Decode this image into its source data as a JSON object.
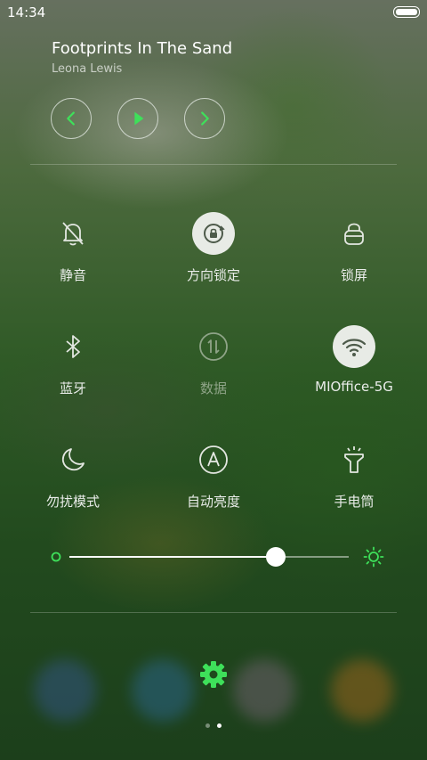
{
  "status": {
    "time": "14:34"
  },
  "media": {
    "title": "Footprints In The Sand",
    "artist": "Leona Lewis",
    "controls": [
      "previous-icon",
      "play-icon",
      "next-icon"
    ]
  },
  "tiles": [
    {
      "label": "静音",
      "icon": "bell-muted-icon",
      "state": "off"
    },
    {
      "label": "方向锁定",
      "icon": "rotation-lock-icon",
      "state": "on"
    },
    {
      "label": "锁屏",
      "icon": "lock-icon",
      "state": "off"
    },
    {
      "label": "蓝牙",
      "icon": "bluetooth-icon",
      "state": "off"
    },
    {
      "label": "数据",
      "icon": "mobile-data-icon",
      "state": "disabled"
    },
    {
      "label": "MIOffice-5G",
      "icon": "wifi-icon",
      "state": "on"
    },
    {
      "label": "勿扰模式",
      "icon": "moon-icon",
      "state": "off"
    },
    {
      "label": "自动亮度",
      "icon": "auto-brightness-icon",
      "state": "off"
    },
    {
      "label": "手电筒",
      "icon": "flashlight-icon",
      "state": "off"
    }
  ],
  "brightness": {
    "value": 0.74
  },
  "pager": {
    "pages": 2,
    "current": 2
  },
  "colors": {
    "accent": "#3ee05a",
    "active_tile_bg": "#e8ebe6"
  }
}
